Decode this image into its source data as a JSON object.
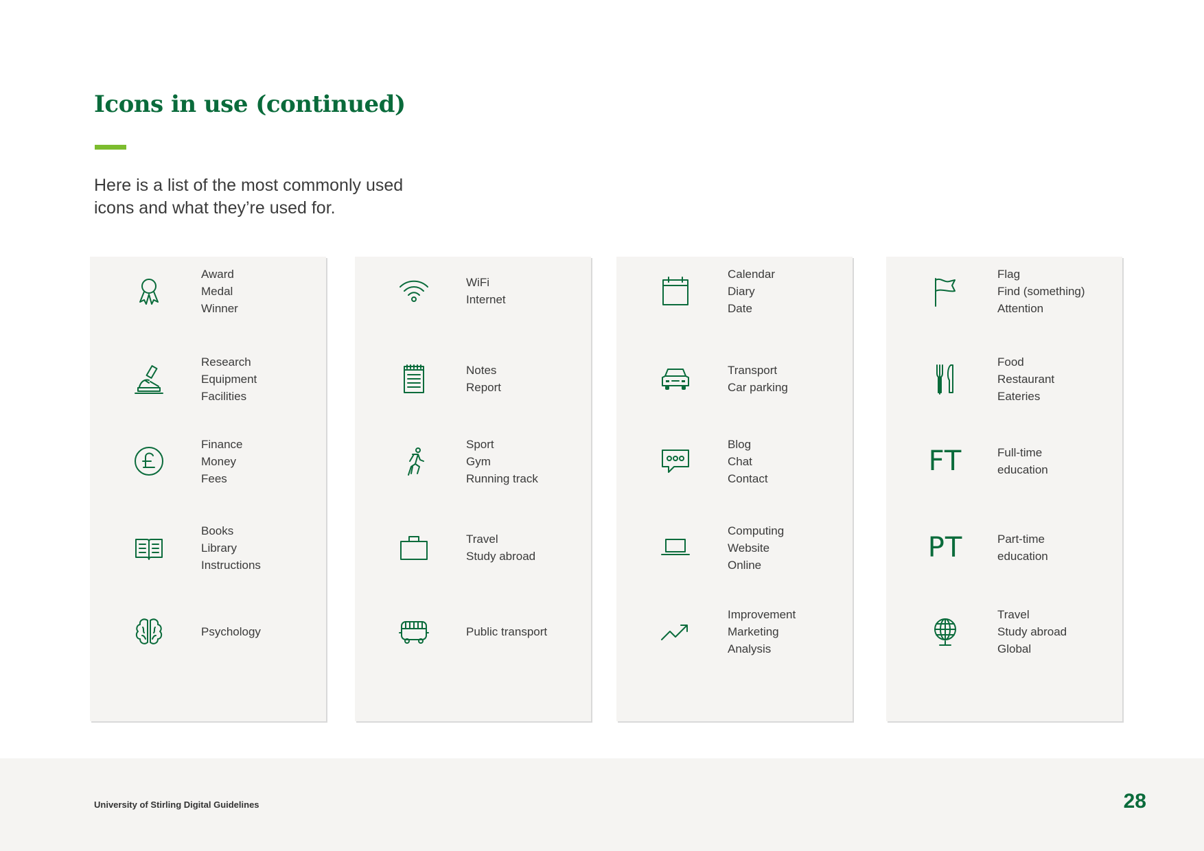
{
  "page": {
    "title": "Icons in use (continued)",
    "intro_line1": "Here is a list of the most commonly used",
    "intro_line2": "icons and what they’re used for."
  },
  "colors": {
    "brand_green": "#0a6b3b",
    "accent_green": "#7cbc2e",
    "card_background": "#f5f4f2"
  },
  "columns": [
    {
      "items": [
        {
          "icon": "award-icon",
          "lines": [
            "Award",
            "Medal",
            "Winner"
          ]
        },
        {
          "icon": "microscope-icon",
          "lines": [
            "Research",
            "Equipment",
            "Facilities"
          ]
        },
        {
          "icon": "pound-coin-icon",
          "lines": [
            "Finance",
            "Money",
            "Fees"
          ]
        },
        {
          "icon": "book-icon",
          "lines": [
            "Books",
            "Library",
            "Instructions"
          ]
        },
        {
          "icon": "brain-icon",
          "lines": [
            "Psychology"
          ]
        }
      ]
    },
    {
      "items": [
        {
          "icon": "wifi-icon",
          "lines": [
            "WiFi",
            "Internet"
          ]
        },
        {
          "icon": "notepad-icon",
          "lines": [
            "Notes",
            "Report"
          ]
        },
        {
          "icon": "runner-icon",
          "lines": [
            "Sport",
            "Gym",
            "Running track"
          ]
        },
        {
          "icon": "briefcase-icon",
          "lines": [
            "Travel",
            "Study abroad"
          ]
        },
        {
          "icon": "bus-icon",
          "lines": [
            "Public transport"
          ]
        }
      ]
    },
    {
      "items": [
        {
          "icon": "calendar-icon",
          "lines": [
            "Calendar",
            "Diary",
            "Date"
          ]
        },
        {
          "icon": "car-icon",
          "lines": [
            "Transport",
            "Car parking"
          ]
        },
        {
          "icon": "chat-icon",
          "lines": [
            "Blog",
            "Chat",
            "Contact"
          ]
        },
        {
          "icon": "laptop-icon",
          "lines": [
            "Computing",
            "Website",
            "Online"
          ]
        },
        {
          "icon": "trend-up-icon",
          "lines": [
            "Improvement",
            "Marketing",
            "Analysis"
          ]
        }
      ]
    },
    {
      "items": [
        {
          "icon": "flag-icon",
          "lines": [
            "Flag",
            "Find (something)",
            "Attention"
          ]
        },
        {
          "icon": "fork-knife-icon",
          "lines": [
            "Food",
            "Restaurant",
            "Eateries"
          ]
        },
        {
          "icon": "full-time-icon",
          "icon_text": "FT",
          "lines": [
            "Full-time",
            "education"
          ]
        },
        {
          "icon": "part-time-icon",
          "icon_text": "PT",
          "lines": [
            "Part-time",
            "education"
          ]
        },
        {
          "icon": "globe-icon",
          "lines": [
            "Travel",
            "Study abroad",
            "Global"
          ]
        }
      ]
    }
  ],
  "footer": {
    "label": "University of Stirling Digital Guidelines",
    "page_number": "28"
  }
}
